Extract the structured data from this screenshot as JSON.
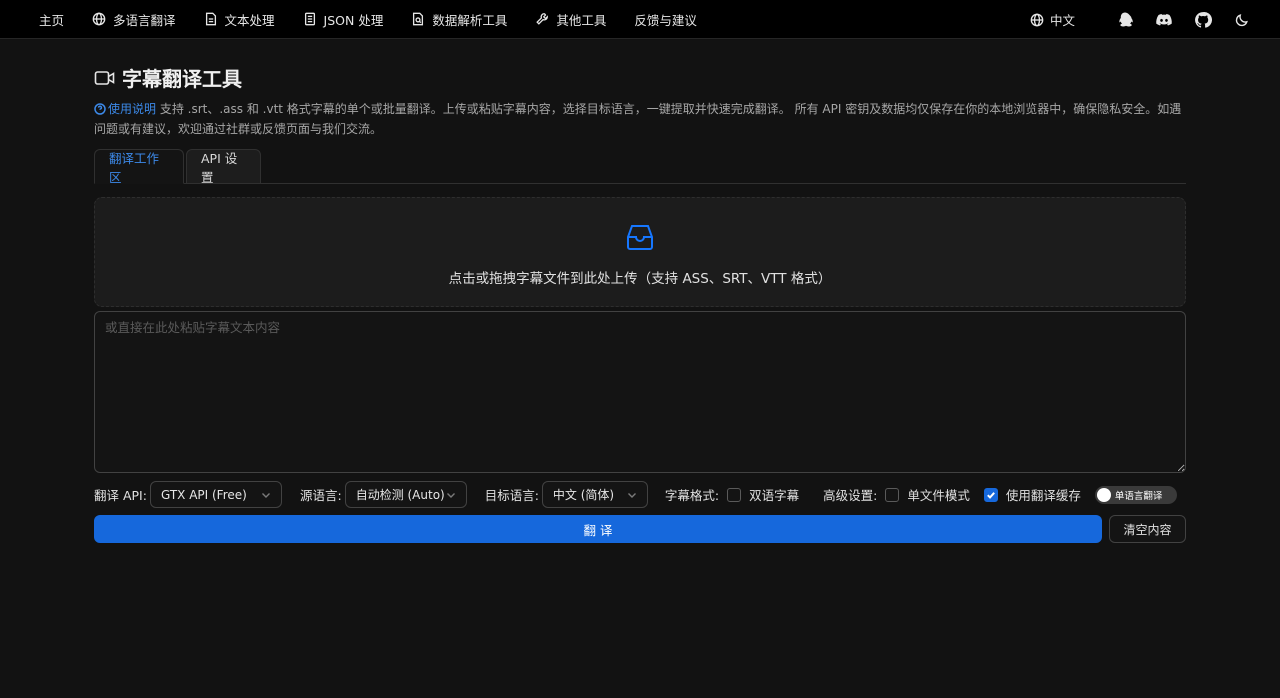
{
  "nav": {
    "items": [
      {
        "label": "主页",
        "icon": "home"
      },
      {
        "label": "多语言翻译",
        "icon": "globe-icon"
      },
      {
        "label": "文本处理",
        "icon": "file-text-icon"
      },
      {
        "label": "JSON 处理",
        "icon": "file-list-icon"
      },
      {
        "label": "数据解析工具",
        "icon": "file-search-icon"
      },
      {
        "label": "其他工具",
        "icon": "wrench-icon"
      },
      {
        "label": "反馈与建议",
        "icon": "none"
      }
    ],
    "language": "中文",
    "icons": [
      "qq-icon",
      "discord-icon",
      "github-icon",
      "moon-icon"
    ]
  },
  "page": {
    "title": "字幕翻译工具",
    "help_link": "使用说明",
    "description": " 支持 .srt、.ass 和 .vtt 格式字幕的单个或批量翻译。上传或粘贴字幕内容，选择目标语言，一键提取并快速完成翻译。 所有 API 密钥及数据均仅保存在你的本地浏览器中，确保隐私安全。如遇问题或有建议，欢迎通过社群或反馈页面与我们交流。"
  },
  "tabs": [
    "翻译工作区",
    "API 设置"
  ],
  "upload": {
    "text": "点击或拖拽字幕文件到此处上传（支持 ASS、SRT、VTT 格式）"
  },
  "paste": {
    "placeholder": "或直接在此处粘贴字幕文本内容",
    "value": ""
  },
  "controls": {
    "api_label": "翻译 API:",
    "api_value": "GTX API (Free)",
    "source_label": "源语言:",
    "source_value": "自动检测 (Auto)",
    "target_label": "目标语言:",
    "target_value": "中文 (简体)",
    "format_label": "字幕格式:",
    "bilingual_label": "双语字幕",
    "bilingual_checked": false,
    "advanced_label": "高级设置:",
    "single_file_label": "单文件模式",
    "single_file_checked": false,
    "cache_label": "使用翻译缓存",
    "cache_checked": true,
    "toggle_label": "单语言翻译"
  },
  "actions": {
    "translate": "翻 译",
    "clear": "清空内容"
  },
  "colors": {
    "accent": "#1668dc",
    "link": "#3c89e8",
    "background": "#121212"
  }
}
